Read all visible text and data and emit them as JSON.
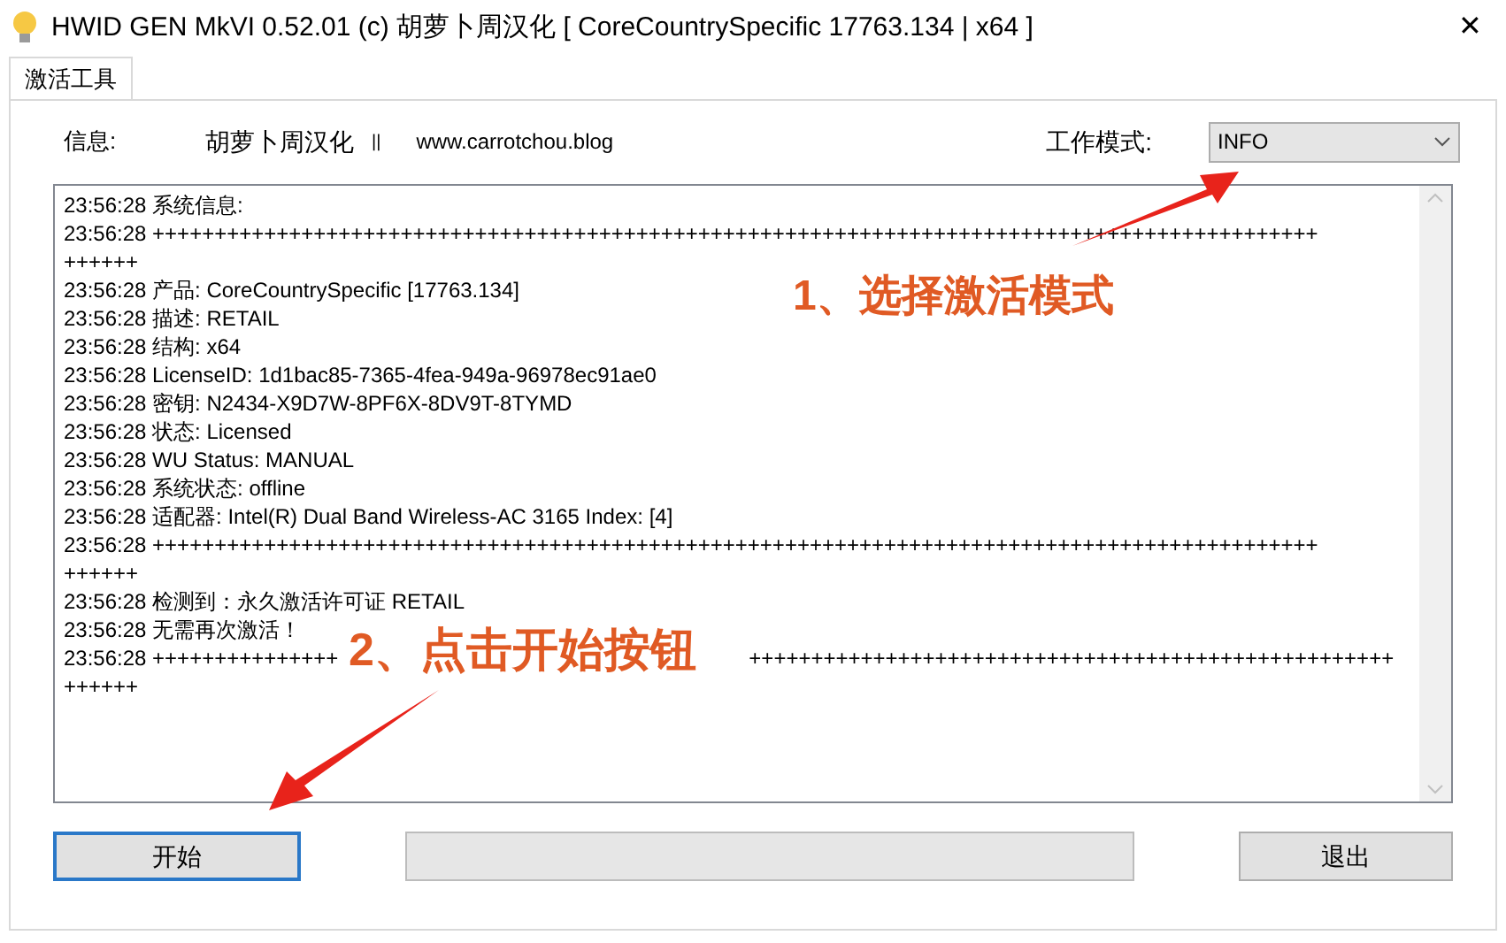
{
  "window": {
    "title": "HWID GEN MkVI 0.52.01 (c) 胡萝卜周汉化 [ CoreCountrySpecific 17763.134 | x64 ]",
    "close": "✕"
  },
  "tabs": [
    {
      "label": "激活工具",
      "selected": true
    }
  ],
  "info": {
    "label": "信息:",
    "author": "胡萝卜周汉化",
    "separator": "||",
    "link": "www.carrotchou.blog"
  },
  "mode": {
    "label": "工作模式:",
    "value": "INFO"
  },
  "log": [
    "23:56:28 系统信息:",
    "23:56:28 ++++++++++++++++++++++++++++++++++++++++++++++++++++++++++++++++++++++++++++++++++++++++++++++",
    "++++++",
    "23:56:28 产品: CoreCountrySpecific [17763.134]",
    "23:56:28 描述: RETAIL",
    "23:56:28 结构: x64",
    "23:56:28 LicenseID: 1d1bac85-7365-4fea-949a-96978ec91ae0",
    "23:56:28 密钥: N2434-X9D7W-8PF6X-8DV9T-8TYMD",
    "23:56:28 状态: Licensed",
    "23:56:28 WU Status: MANUAL",
    "23:56:28 系统状态: offline",
    "23:56:28 适配器: Intel(R) Dual Band Wireless-AC 3165 Index: [4]",
    "23:56:28 ++++++++++++++++++++++++++++++++++++++++++++++++++++++++++++++++++++++++++++++++++++++++++++++",
    "++++++",
    "23:56:28 检测到：永久激活许可证 RETAIL",
    "23:56:28 无需再次激活！",
    [
      "23:56:28 +++++++++++++++",
      "++++++++++++++++++++++++++++++++++++++++++++++++++++"
    ],
    "++++++"
  ],
  "buttons": {
    "start": "开始",
    "exit": "退出"
  },
  "annotations": [
    "1、选择激活模式",
    "2、点击开始按钮"
  ]
}
